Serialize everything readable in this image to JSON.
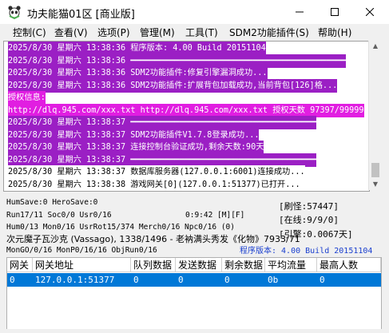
{
  "window": {
    "title": "功夫能猫01区 [商业版]",
    "minimize_icon": "minimize-icon",
    "maximize_icon": "maximize-icon",
    "close_icon": "close-icon"
  },
  "menu": [
    "控制(C)",
    "查看(V)",
    "选项(P)",
    "管理(M)",
    "工具(T)",
    "SDM2功能插件(S)",
    "帮助(H)"
  ],
  "log": {
    "lines": [
      {
        "text": "2025/8/30 星期六 13:38:36 程序版本: 4.00 Build 20151104",
        "color": "#ffffff",
        "bg": "#9b1fc4"
      },
      {
        "text": "2025/8/30 星期六 13:38:36 ━━━━━━━━━━━━━━━━━━━━━━━━━━━━━━━━━━━━━━━━━━━━",
        "color": "#ffffff",
        "bg": "#9b1fc4"
      },
      {
        "text": "2025/8/30 星期六 13:38:36 SDM2功能插件:修复引擎漏洞成功...",
        "color": "#ffffff",
        "bg": "#9b1fc4"
      },
      {
        "text": "2025/8/30 星期六 13:38:36 SDM2功能插件:扩展背包加载成功,当前背包[126]格...",
        "color": "#ffffff",
        "bg": "#9b1fc4"
      },
      {
        "text": "授权信息:",
        "color": "#ffffff",
        "bg": "#e11ee1"
      },
      {
        "text": "http://dlq.945.com/xxx.txt http://dlq.945.com/xxx.txt 授权天数 97397/99999",
        "color": "#ffffff",
        "bg": "#e11ee1"
      },
      {
        "text": "2025/8/30 星期六 13:38:37 ━━━━━━━━━━━━━━━━━━━━━━━━━━━━━━━━━━━━━━",
        "color": "#ffffff",
        "bg": "#9b1fc4"
      },
      {
        "text": "2025/8/30 星期六 13:38:37 SDM2功能插件V1.7.8登录成功...",
        "color": "#ffffff",
        "bg": "#9b1fc4"
      },
      {
        "text": "2025/8/30 星期六 13:38:37 连接控制台验证成功,剩余天数:90天",
        "color": "#ffffff",
        "bg": "#9b1fc4"
      },
      {
        "text": "2025/8/30 星期六 13:38:37 ━━━━━━━━━━━━━━━━━━━━━━━━━━━━━━━━━━━━━━",
        "color": "#ffffff",
        "bg": "#9b1fc4"
      },
      {
        "text": "2025/8/30 星期六 13:38:37 数据库服务器(127.0.0.1:6001)连接成功...",
        "color": "#000000",
        "bg": "#ffffff"
      },
      {
        "text": "2025/8/30 星期六 13:38:38 游戏网关[0](127.0.0.1:51377)已打开...",
        "color": "#000000",
        "bg": "#ffffff"
      }
    ]
  },
  "stats": {
    "humsave": "HumSave:0 HeroSave:0",
    "run": "Run17/11 Soc0/0 Usr0/16",
    "time": "0:9:42 [M][F]",
    "hum": "Hum0/13 Mon0/16 UsrRot15/374 Merch0/16 Npc0/16 (0)",
    "mapinfo": "次元魔子瓦沙克 (Vassago), 1338/1496 - 老衲满头秀发《化物》7933/71",
    "mon": "MonGO/0/16 MonP0/16/16 ObjRun0/16",
    "refresh": "[刷怪:57447]",
    "online": "[在线:9/9/0]",
    "ratio": "[引擎:0.0067天]",
    "version": "程序版本: 4.00 Build 20151104"
  },
  "table": {
    "headers": [
      "网关",
      "网关地址",
      "队列数据",
      "发送数据",
      "剩余数据",
      "平均流量",
      "最高人数"
    ],
    "rows": [
      [
        "0",
        "127.0.0.1:51377",
        "0",
        "0",
        "0",
        "0b",
        "0"
      ]
    ]
  },
  "colors": {
    "selection": "#0078d7",
    "log_purple": "#9b1fc4",
    "log_magenta": "#e11ee1",
    "version_blue": "#1a3fcf"
  }
}
